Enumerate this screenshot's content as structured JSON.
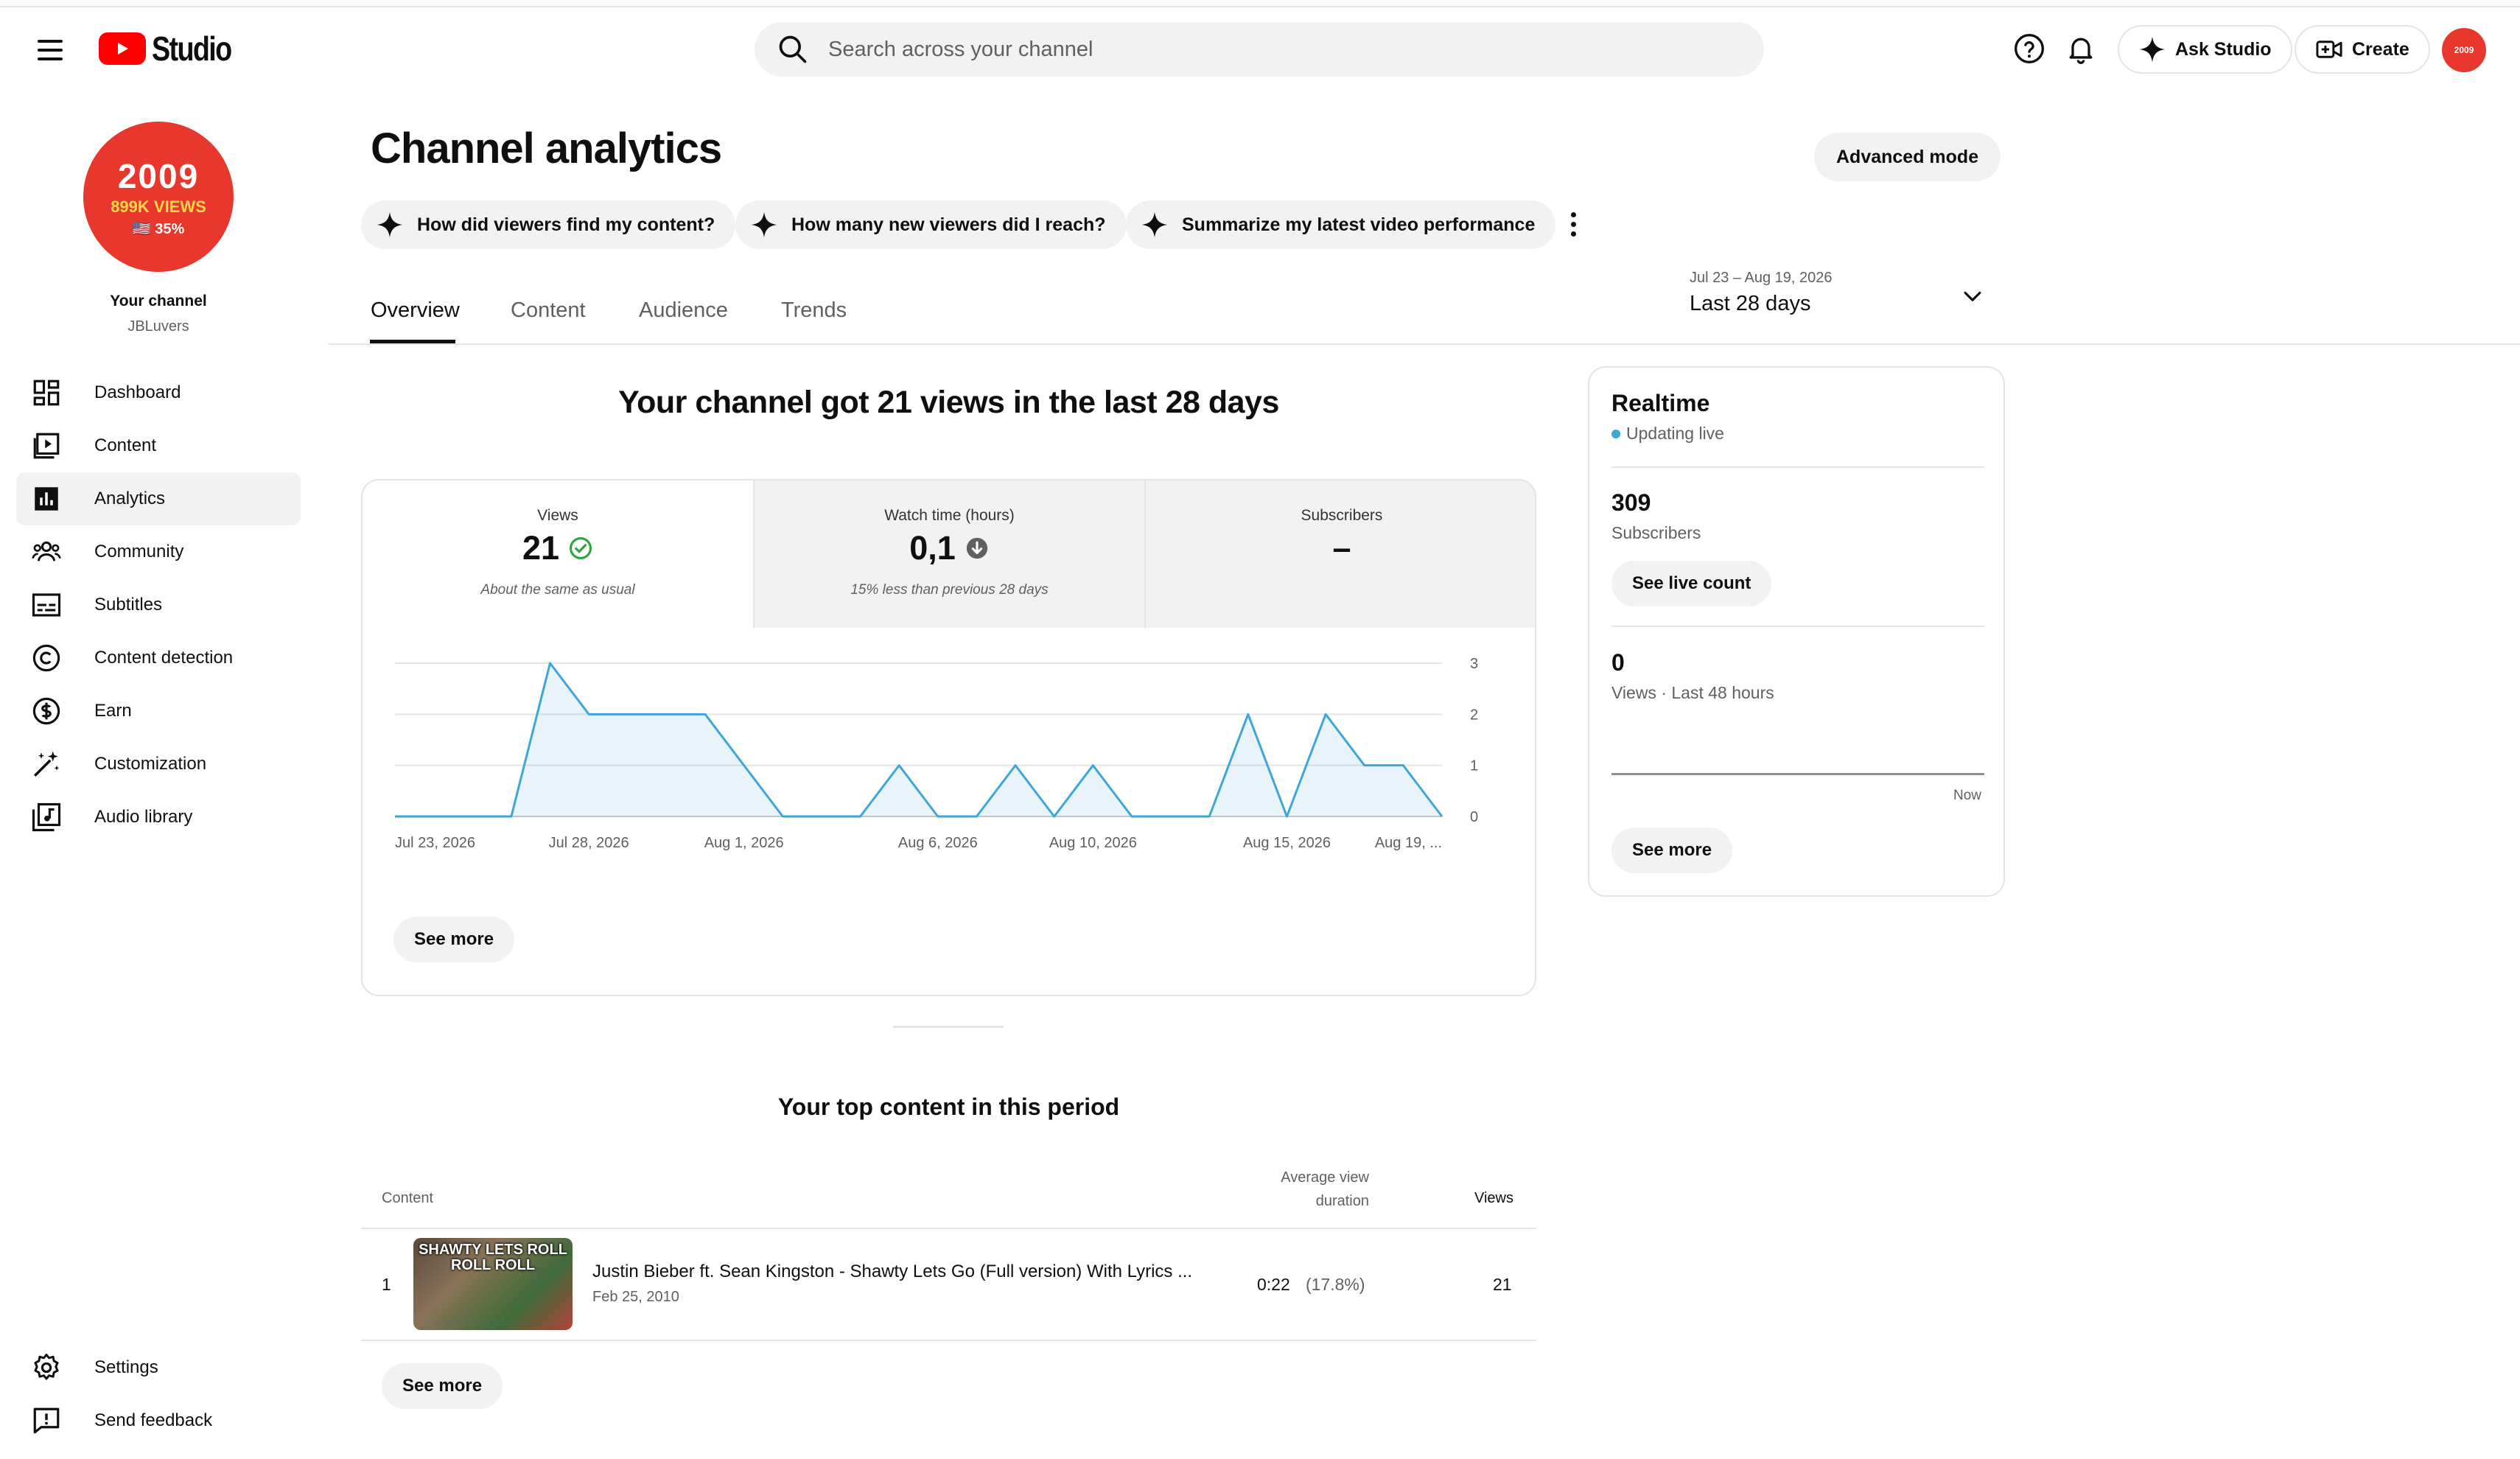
{
  "header": {
    "logo_text": "Studio",
    "search_placeholder": "Search across your channel",
    "ask_studio_label": "Ask Studio",
    "create_label": "Create",
    "avatar_text": "2009"
  },
  "sidebar": {
    "avatar": {
      "line1": "2009",
      "line2": "899K VIEWS",
      "line3": "🇺🇸 35%"
    },
    "channel_title": "Your channel",
    "channel_handle": "JBLuvers",
    "items": [
      {
        "label": "Dashboard",
        "icon": "dashboard-icon"
      },
      {
        "label": "Content",
        "icon": "content-icon"
      },
      {
        "label": "Analytics",
        "icon": "analytics-icon",
        "active": true
      },
      {
        "label": "Community",
        "icon": "community-icon"
      },
      {
        "label": "Subtitles",
        "icon": "subtitles-icon"
      },
      {
        "label": "Content detection",
        "icon": "copyright-icon"
      },
      {
        "label": "Earn",
        "icon": "earn-icon"
      },
      {
        "label": "Customization",
        "icon": "customization-icon"
      },
      {
        "label": "Audio library",
        "icon": "audio-library-icon"
      }
    ],
    "footer": [
      {
        "label": "Settings",
        "icon": "gear-icon"
      },
      {
        "label": "Send feedback",
        "icon": "feedback-icon"
      }
    ]
  },
  "main": {
    "title": "Channel analytics",
    "advanced_mode_label": "Advanced mode",
    "chips": [
      "How did viewers find my content?",
      "How many new viewers did I reach?",
      "Summarize my latest video performance"
    ],
    "tabs": [
      "Overview",
      "Content",
      "Audience",
      "Trends"
    ],
    "active_tab": "Overview",
    "date_range": {
      "sub": "Jul 23 – Aug 19, 2026",
      "main": "Last 28 days"
    },
    "headline": "Your channel got 21 views in the last 28 days",
    "metrics": [
      {
        "label": "Views",
        "value": "21",
        "note": "About the same as usual",
        "status": "check"
      },
      {
        "label": "Watch time (hours)",
        "value": "0,1",
        "note": "15% less than previous 28 days",
        "status": "down"
      },
      {
        "label": "Subscribers",
        "value": "–",
        "note": ""
      }
    ],
    "chart_see_more": "See more",
    "top_content": {
      "title": "Your top content in this period",
      "headers": {
        "content": "Content",
        "avg_line1": "Average view",
        "avg_line2": "duration",
        "views": "Views"
      },
      "rows": [
        {
          "rank": "1",
          "thumb_text": "SHAWTY LETS ROLL ROLL ROLL",
          "title": "Justin Bieber ft. Sean Kingston - Shawty Lets Go (Full version) With Lyrics ...",
          "date": "Feb 25, 2010",
          "avg_duration": "0:22",
          "avg_pct": "(17.8%)",
          "views": "21"
        }
      ],
      "see_more": "See more"
    }
  },
  "realtime": {
    "title": "Realtime",
    "live_text": "Updating live",
    "subscribers_value": "309",
    "subscribers_label": "Subscribers",
    "live_count_button": "See live count",
    "views_value": "0",
    "views_label": "Views · Last 48 hours",
    "now_label": "Now",
    "see_more": "See more"
  },
  "colors": {
    "accent": "#3ea6d8",
    "brand": "#ff0000",
    "check": "#2ba640",
    "gray_bg": "#f2f2f2"
  },
  "chart_data": {
    "type": "area",
    "x": [
      "Jul 23, 2026",
      "Jul 24",
      "Jul 25",
      "Jul 26",
      "Jul 27",
      "Jul 28, 2026",
      "Jul 29",
      "Jul 30",
      "Jul 31",
      "Aug 1, 2026",
      "Aug 2",
      "Aug 3",
      "Aug 4",
      "Aug 5",
      "Aug 6, 2026",
      "Aug 7",
      "Aug 8",
      "Aug 9",
      "Aug 10, 2026",
      "Aug 11",
      "Aug 12",
      "Aug 13",
      "Aug 14",
      "Aug 15, 2026",
      "Aug 16",
      "Aug 17",
      "Aug 18",
      "Aug 19, ..."
    ],
    "series": [
      {
        "values": [
          0,
          0,
          0,
          0,
          3,
          2,
          2,
          2,
          2,
          1,
          0,
          0,
          0,
          1,
          0,
          0,
          1,
          0,
          1,
          0,
          0,
          0,
          2,
          0,
          2,
          1,
          1,
          0
        ]
      }
    ],
    "tick_labels_x": [
      "Jul 23, 2026",
      "Jul 28, 2026",
      "Aug 1, 2026",
      "Aug 6, 2026",
      "Aug 10, 2026",
      "Aug 15, 2026",
      "Aug 19, ..."
    ],
    "tick_labels_y": [
      "3",
      "2",
      "1",
      "0"
    ],
    "ylim": [
      0,
      3
    ],
    "grid": true,
    "color": "#3ea6d8"
  }
}
